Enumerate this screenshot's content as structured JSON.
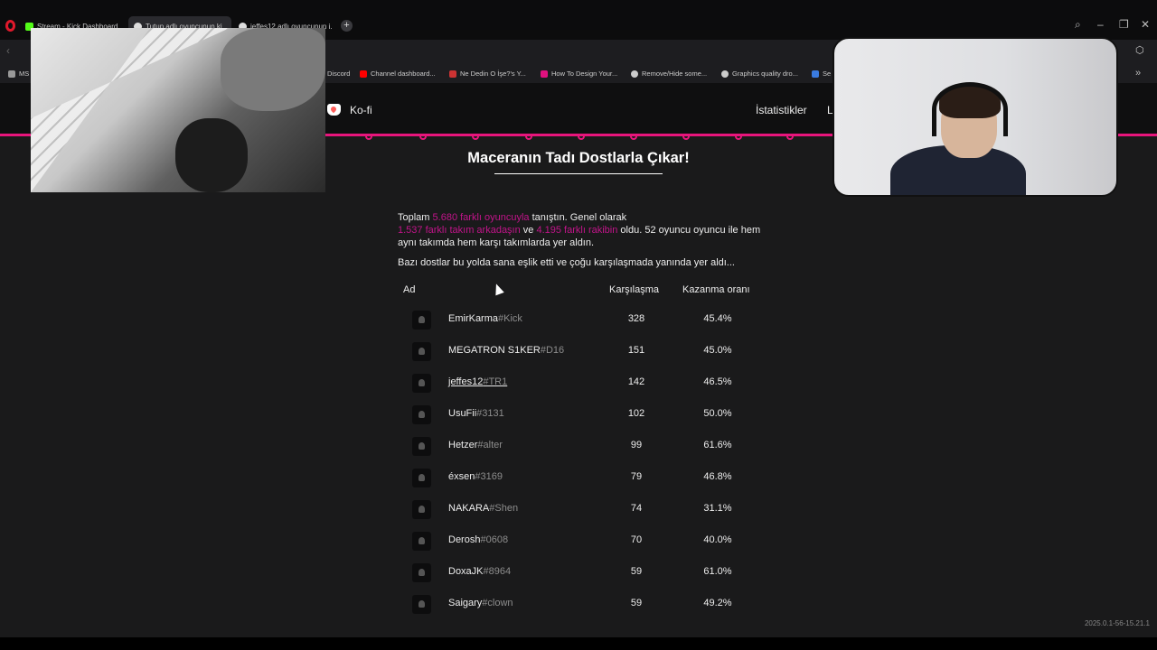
{
  "browser": {
    "tabs": [
      {
        "label": "Stream - Kick Dashboard"
      },
      {
        "label": "Tutup adlı oyuncunun ki..."
      },
      {
        "label": "jeffes12 adlı oyuncunun i..."
      }
    ],
    "bookmarks": [
      {
        "label": "MS"
      },
      {
        "label": "Discord"
      },
      {
        "label": "Channel dashboard..."
      },
      {
        "label": "Ne Dedin O İşe?'s Y..."
      },
      {
        "label": "How To Design Your..."
      },
      {
        "label": "Remove/Hide some..."
      },
      {
        "label": "Graphics quality dro..."
      },
      {
        "label": "Se"
      }
    ]
  },
  "nav": {
    "kofi": "Ko-fi",
    "stats": "İstatistikler",
    "partial": "L"
  },
  "main": {
    "heading": "Maceranın Tadı Dostlarla Çıkar!",
    "intro": {
      "t1": "Toplam ",
      "players_hl": "5.680 farklı oyuncuyla",
      "t2": " tanıştın. Genel olarak",
      "teammates_hl": "1.537 farklı takım arkadaşın",
      "t3": " ve ",
      "opponents_hl": "4.195 farklı rakibin",
      "t4": " oldu. 52 oyuncu oyuncu ile hem aynı takımda hem karşı takımlarda yer aldın."
    },
    "subtitle": "Bazı dostlar bu yolda sana eşlik etti ve çoğu karşılaşmada yanında yer aldı...",
    "table": {
      "headers": {
        "name": "Ad",
        "matches": "Karşılaşma",
        "winrate": "Kazanma oranı"
      },
      "rows": [
        {
          "name": "EmirKarma",
          "tag": "#Kick",
          "matches": "328",
          "winrate": "45.4%"
        },
        {
          "name": "MEGATRON S1KER",
          "tag": "#D16",
          "matches": "151",
          "winrate": "45.0%"
        },
        {
          "name": "jeffes12",
          "tag": "#TR1",
          "matches": "142",
          "winrate": "46.5%"
        },
        {
          "name": "UsuFii",
          "tag": "#3131",
          "matches": "102",
          "winrate": "50.0%"
        },
        {
          "name": "Hetzer",
          "tag": "#alter",
          "matches": "99",
          "winrate": "61.6%"
        },
        {
          "name": "éxsen",
          "tag": "#3169",
          "matches": "79",
          "winrate": "46.8%"
        },
        {
          "name": "NAKARA",
          "tag": "#Shen",
          "matches": "74",
          "winrate": "31.1%"
        },
        {
          "name": "Derosh",
          "tag": "#0608",
          "matches": "70",
          "winrate": "40.0%"
        },
        {
          "name": "DoxaJK",
          "tag": "#8964",
          "matches": "59",
          "winrate": "61.0%"
        },
        {
          "name": "Saigary",
          "tag": "#clown",
          "matches": "59",
          "winrate": "49.2%"
        }
      ]
    }
  },
  "footer": {
    "version": "2025.0.1-56-15.21.1"
  },
  "colors": {
    "accent": "#e8157c",
    "highlight": "#c2148a",
    "background": "#1a1a1b"
  }
}
